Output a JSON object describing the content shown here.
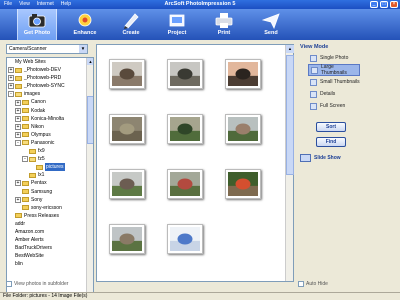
{
  "window": {
    "title": "ArcSoft PhotoImpression 5",
    "menu": [
      "File",
      "View",
      "Internet",
      "Help"
    ],
    "controls": {
      "minimize": "_",
      "maximize": "□",
      "close": "×"
    }
  },
  "toolbar": {
    "items": [
      {
        "label": "Get Photo",
        "icon": "camera-icon",
        "active": true
      },
      {
        "label": "Enhance",
        "icon": "enhance-icon",
        "active": false
      },
      {
        "label": "Create",
        "icon": "create-icon",
        "active": false
      },
      {
        "label": "Project",
        "icon": "project-icon",
        "active": false
      },
      {
        "label": "Print",
        "icon": "printer-icon",
        "active": false
      },
      {
        "label": "Send",
        "icon": "send-icon",
        "active": false
      }
    ]
  },
  "source": {
    "selected": "Camera/Scanner"
  },
  "tree": [
    {
      "label": "My Web Sites",
      "level": 0,
      "exp": "",
      "folder": false
    },
    {
      "label": "_Photoweb-DEV",
      "level": 0,
      "exp": "+",
      "folder": true
    },
    {
      "label": "_Photoweb-PRD",
      "level": 0,
      "exp": "+",
      "folder": true
    },
    {
      "label": "_Photoweb-SYNC",
      "level": 0,
      "exp": "+",
      "folder": true
    },
    {
      "label": "images",
      "level": 0,
      "exp": "-",
      "folder": true
    },
    {
      "label": "Canon",
      "level": 1,
      "exp": "+",
      "folder": true
    },
    {
      "label": "Kodak",
      "level": 1,
      "exp": "+",
      "folder": true
    },
    {
      "label": "Konica-Minolta",
      "level": 1,
      "exp": "+",
      "folder": true
    },
    {
      "label": "Nikon",
      "level": 1,
      "exp": "+",
      "folder": true
    },
    {
      "label": "Olympus",
      "level": 1,
      "exp": "+",
      "folder": true
    },
    {
      "label": "Panasonic",
      "level": 1,
      "exp": "-",
      "folder": true
    },
    {
      "label": "fx9",
      "level": 2,
      "exp": "",
      "folder": true
    },
    {
      "label": "fz5",
      "level": 2,
      "exp": "-",
      "folder": true
    },
    {
      "label": "pictures",
      "level": 3,
      "exp": "",
      "folder": true,
      "selected": true
    },
    {
      "label": "lx1",
      "level": 2,
      "exp": "",
      "folder": true
    },
    {
      "label": "Pentax",
      "level": 1,
      "exp": "+",
      "folder": true
    },
    {
      "label": "Samsung",
      "level": 1,
      "exp": "",
      "folder": true
    },
    {
      "label": "Sony",
      "level": 1,
      "exp": "+",
      "folder": true
    },
    {
      "label": "sony-ericsson",
      "level": 1,
      "exp": "",
      "folder": true
    },
    {
      "label": "Press Releases",
      "level": 0,
      "exp": "",
      "folder": true
    },
    {
      "label": "addr",
      "level": 0,
      "exp": "",
      "folder": false
    },
    {
      "label": "Amazon.com",
      "level": 0,
      "exp": "",
      "folder": false
    },
    {
      "label": "Amber Alerts",
      "level": 0,
      "exp": "",
      "folder": false
    },
    {
      "label": "BadTruckDrivers",
      "level": 0,
      "exp": "",
      "folder": false
    },
    {
      "label": "BestWebSite",
      "level": 0,
      "exp": "",
      "folder": false
    },
    {
      "label": "blin",
      "level": 0,
      "exp": "",
      "folder": false
    }
  ],
  "subfolder_option": {
    "label": "View photos in subfolder",
    "checked": false
  },
  "thumbnails": [
    {
      "subject": "brown-leaves-photo",
      "sky": "#cfcac2",
      "ground": "#8a7a6a",
      "accent": "#5a4a3c"
    },
    {
      "subject": "bare-tree-photo",
      "sky": "#c7c6c2",
      "ground": "#6e6a60",
      "accent": "#3a3a33"
    },
    {
      "subject": "tree-sunset-photo",
      "sky": "#e2b79c",
      "ground": "#4c3d33",
      "accent": "#2b241f"
    },
    {
      "subject": "dry-grass-photo",
      "sky": "#8d8571",
      "ground": "#6b624f",
      "accent": "#a39b7f"
    },
    {
      "subject": "shrubs-photo",
      "sky": "#a6a58e",
      "ground": "#506c3b",
      "accent": "#2f4628"
    },
    {
      "subject": "house-yard-photo",
      "sky": "#b8c0bf",
      "ground": "#4f6a3b",
      "accent": "#9a7f6b"
    },
    {
      "subject": "shed-photo",
      "sky": "#c6c9c6",
      "ground": "#5e7a45",
      "accent": "#6c5d52"
    },
    {
      "subject": "red-bush-photo",
      "sky": "#a3a898",
      "ground": "#5a7040",
      "accent": "#b34a3f"
    },
    {
      "subject": "flower-pot-photo",
      "sky": "#3f5e2c",
      "ground": "#7e6a4f",
      "accent": "#d44f2f"
    },
    {
      "subject": "fence-photo",
      "sky": "#bfc4c6",
      "ground": "#5b7342",
      "accent": "#8a7a66"
    },
    {
      "subject": "screenshot-thumb-photo",
      "sky": "#eef2f7",
      "ground": "#c8d4e6",
      "accent": "#4e79c9"
    }
  ],
  "autohide": {
    "label": "Auto Hide",
    "checked": false
  },
  "view_mode": {
    "title": "View Mode",
    "items": [
      {
        "label": "Single Photo",
        "active": false
      },
      {
        "label": "Large Thumbnails",
        "active": true
      },
      {
        "label": "Small Thumbnails",
        "active": false
      },
      {
        "label": "Details",
        "active": false
      },
      {
        "label": "Full Screen",
        "active": false
      }
    ],
    "sort_label": "Sort",
    "find_label": "Find",
    "slideshow_label": "Slide Show"
  },
  "status": {
    "text": "File Folder: pictures - 14 Image File(s)"
  },
  "colors": {
    "titlebar": "#1c4fc2",
    "toolbar": "#2452b8",
    "selection": "#316ac5",
    "accent": "#1c3f95"
  }
}
